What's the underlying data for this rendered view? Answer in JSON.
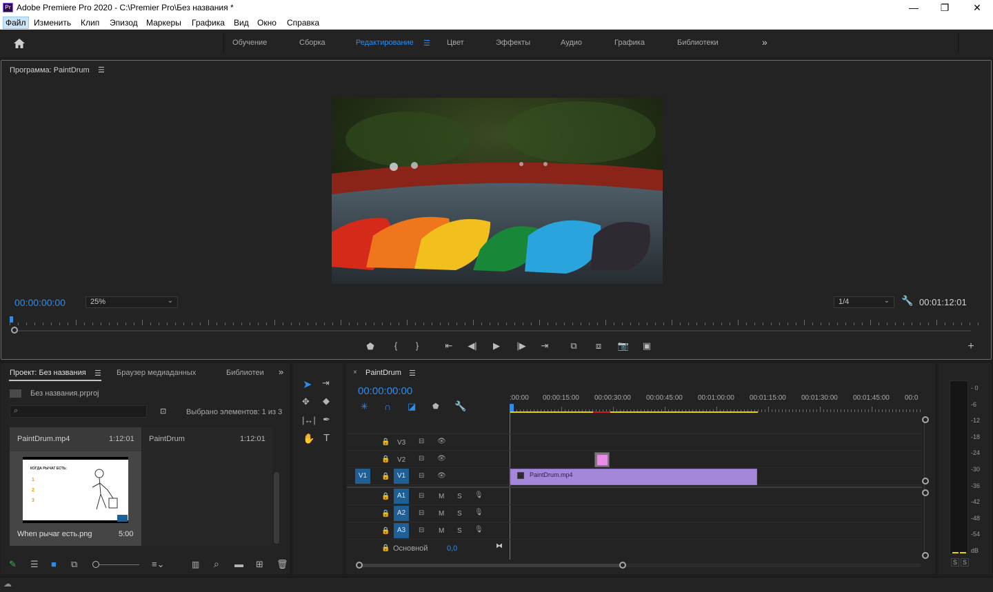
{
  "window": {
    "title": "Adobe Premiere Pro 2020 - C:\\Premier Pro\\Без названия *",
    "logo": "Pr"
  },
  "menu": [
    "Файл",
    "Изменить",
    "Клип",
    "Эпизод",
    "Маркеры",
    "Графика",
    "Вид",
    "Окно",
    "Справка"
  ],
  "workspaces": [
    "Обучение",
    "Сборка",
    "Редактирование",
    "Цвет",
    "Эффекты",
    "Аудио",
    "Графика",
    "Библиотеки"
  ],
  "workspace_active": "Редактирование",
  "program": {
    "title": "Программа: PaintDrum",
    "timecode": "00:00:00:00",
    "zoom": "25%",
    "resolution": "1/4",
    "duration": "00:01:12:01",
    "playhead_fraction": 0
  },
  "project": {
    "tabs": [
      "Проект: Без названия",
      "Браузер медиаданных",
      "Библиотеи"
    ],
    "file": "Без названия.prproj",
    "selected": "Выбрано элементов: 1 из 3",
    "search_placeholder": "",
    "items": [
      {
        "name": "PaintDrum.mp4",
        "duration": "1:12:01"
      },
      {
        "name": "PaintDrum",
        "duration": "1:12:01"
      },
      {
        "name": "When рычаг есть.png",
        "duration": "5:00"
      }
    ],
    "thumb_text": {
      "heading": "КОГДА РЫЧАГ ЕСТЬ:",
      "bullets": [
        "1",
        "2",
        "3"
      ]
    }
  },
  "timeline": {
    "tab": "PaintDrum",
    "timecode": "00:00:00:00",
    "ruler": [
      ":00:00",
      "00:00:15:00",
      "00:00:30:00",
      "00:00:45:00",
      "00:01:00:00",
      "00:01:15:00",
      "00:01:30:00",
      "00:01:45:00",
      "00:0"
    ],
    "video_tracks": [
      "V3",
      "V2",
      "V1"
    ],
    "audio_tracks": [
      "A1",
      "A2",
      "A3"
    ],
    "source_v": "V1",
    "mute_label": "M",
    "solo_label": "S",
    "master": "Основной",
    "master_value": "0,0",
    "clip": "PaintDrum.mp4"
  },
  "meter": {
    "labels": [
      "0",
      "-6",
      "-12",
      "-18",
      "-24",
      "-30",
      "-36",
      "-42",
      "-48",
      "-54",
      "dB"
    ],
    "solo": [
      "S",
      "S"
    ]
  },
  "colors": {
    "accent": "#2d8ceb",
    "clip_video": "#a587da",
    "clip_graphic": "#e88ce6",
    "work_area": "#e6d400",
    "render_red": "#d11a1a"
  }
}
